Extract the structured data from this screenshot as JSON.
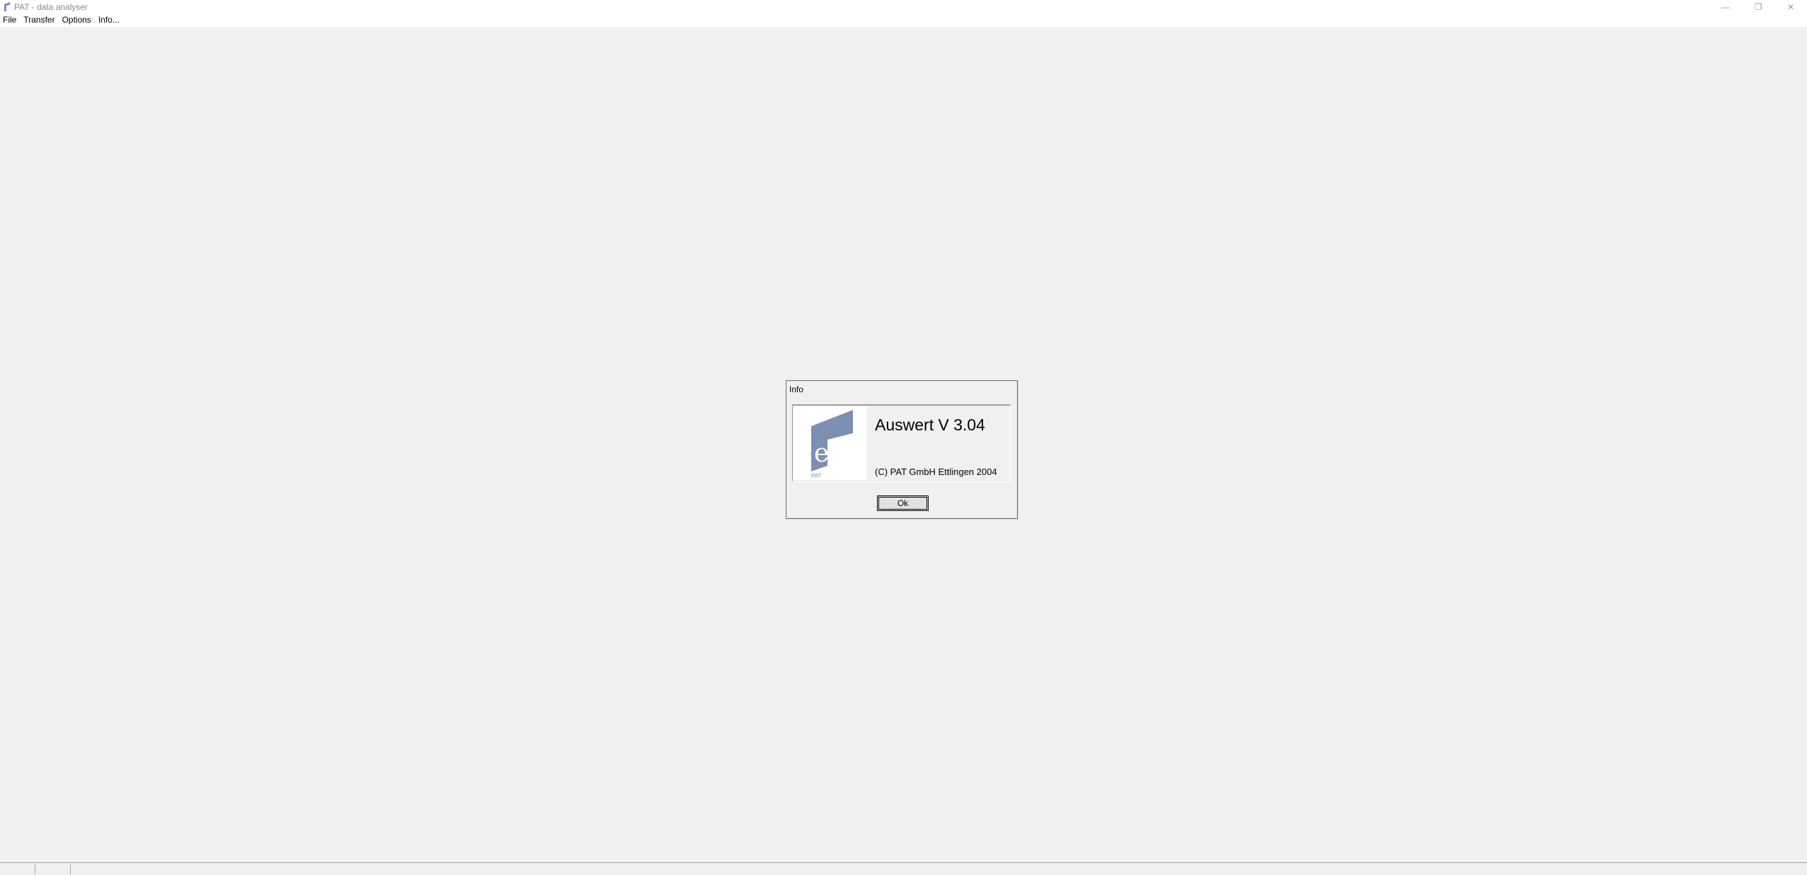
{
  "window": {
    "title": "PAT - data analyser",
    "minimize": "—",
    "maximize": "❐",
    "close": "✕"
  },
  "menu": {
    "items": [
      {
        "label": "File"
      },
      {
        "label": "Transfer"
      },
      {
        "label": "Options"
      },
      {
        "label": "Info..."
      }
    ]
  },
  "dialog": {
    "title": "Info",
    "product": "Auswert V 3.04",
    "copyright": "(C) PAT GmbH Ettlingen 2004",
    "logo_caption": "PAT",
    "logo_letter": "e",
    "ok_label": "Ok"
  },
  "colors": {
    "logo": "#7d8fb3",
    "background": "#f0f0f0"
  }
}
